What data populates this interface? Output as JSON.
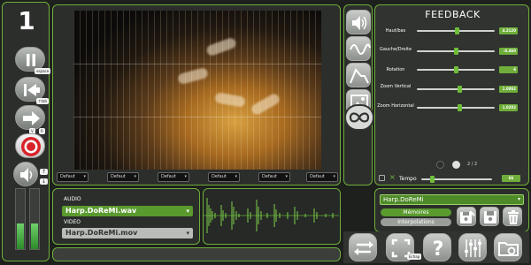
{
  "scene_number": "1",
  "transport": {
    "pause_tag": "espace",
    "back_tag": "↑tab",
    "record_tag_v": "V",
    "record_tag_r": "R",
    "volume_up_tag": "↑",
    "volume_down_tag": "↓"
  },
  "video": {
    "defaults": [
      "Defaut",
      "Defaut",
      "Defaut",
      "Defaut",
      "Defaut",
      "Defaut"
    ]
  },
  "audio": {
    "audio_label": "AUDIO",
    "audio_file": "Harp.DoReMi.wav",
    "video_label": "VIDEO",
    "video_file": "Harp.DoReMi.mov"
  },
  "feedback": {
    "title": "FEEDBACK",
    "params": [
      {
        "label": "Haut/bas",
        "value": "4.2120",
        "level": 0.52
      },
      {
        "label": "Gauche/Droite",
        "value": "-0.460",
        "level": 0.5
      },
      {
        "label": "Rotation",
        "value": "6",
        "level": 0.51
      },
      {
        "label": "Zoom Vertical",
        "value": "1.0002",
        "level": 0.55
      },
      {
        "label": "Zoom Horizontal",
        "value": "1.0202",
        "level": 0.55
      }
    ],
    "page_indicator": "2 / 2",
    "tempo_label": "Tempo",
    "tempo_value": "66",
    "tempo_level": 0.15
  },
  "memories": {
    "current": "Harp.DoReMi",
    "memories_label": "Mémoires",
    "interpolations_label": "Interpolations"
  },
  "toolbar": {
    "fullscreen_tag": "Echap"
  },
  "colors": {
    "accent": "#6fae3a",
    "panel": "#2b2e2b",
    "record": "#d9232a"
  }
}
